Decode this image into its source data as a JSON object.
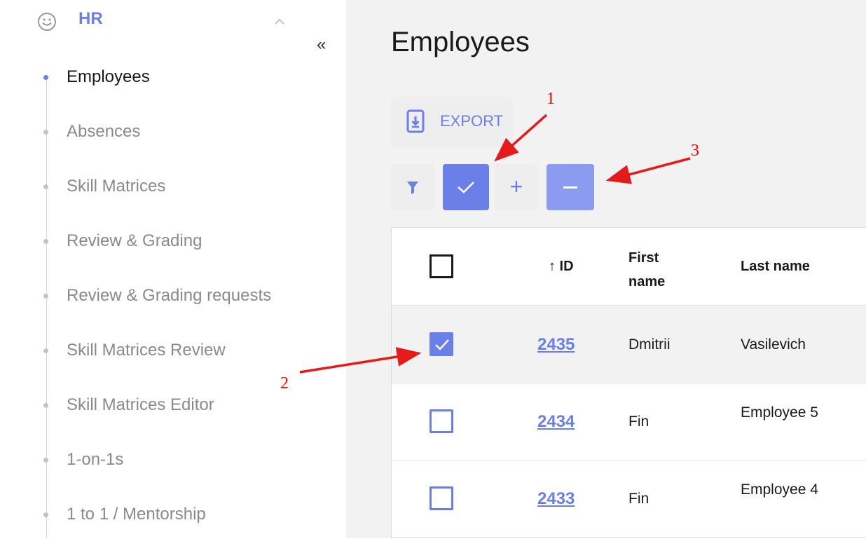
{
  "sidebar": {
    "section_title": "HR",
    "collapse_glyph": "«",
    "items": [
      {
        "label": "Employees",
        "active": true
      },
      {
        "label": "Absences"
      },
      {
        "label": "Skill Matrices"
      },
      {
        "label": "Review & Grading"
      },
      {
        "label": "Review & Grading requests"
      },
      {
        "label": "Skill Matrices Review"
      },
      {
        "label": "Skill Matrices Editor"
      },
      {
        "label": "1-on-1s"
      },
      {
        "label": "1 to 1 / Mentorship"
      }
    ]
  },
  "main": {
    "title": "Employees",
    "export_label": "EXPORT",
    "plus_glyph": "+",
    "table": {
      "headers": {
        "id": "↑ ID",
        "first_name": "First name",
        "last_name": "Last name"
      },
      "rows": [
        {
          "id": "2435",
          "first_name": "Dmitrii",
          "last_name": "Vasilevich",
          "selected": true
        },
        {
          "id": "2434",
          "first_name": "Fin",
          "last_name": "Employee 5",
          "selected": false
        },
        {
          "id": "2433",
          "first_name": "Fin",
          "last_name": "Employee 4",
          "selected": false
        }
      ]
    }
  },
  "annotations": [
    "1",
    "2",
    "3"
  ],
  "colors": {
    "accent": "#6b7fe8",
    "annotation": "#ff0000",
    "main_bg": "#f2f2f2"
  }
}
